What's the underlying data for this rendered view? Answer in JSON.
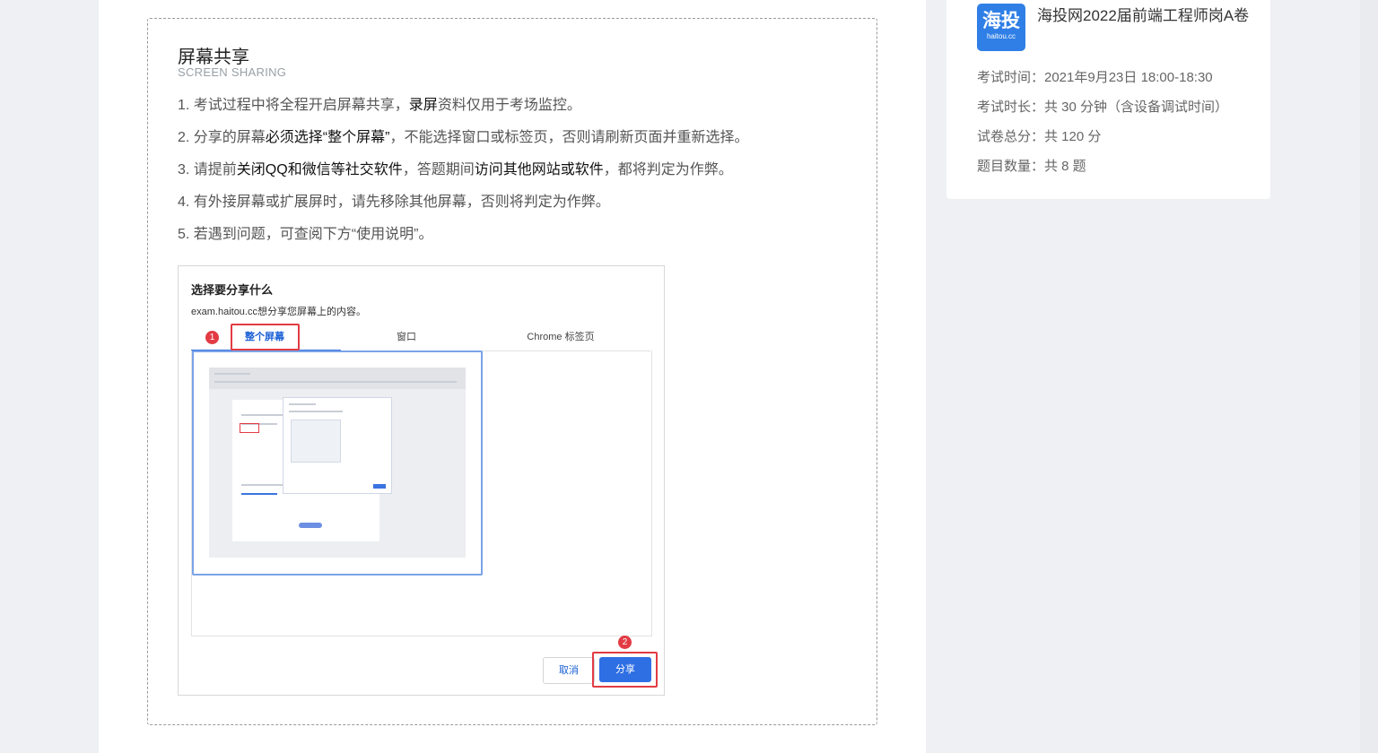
{
  "section": {
    "title": "屏幕共享",
    "subtitle": "SCREEN SHARING",
    "rules": [
      [
        {
          "t": "1. 考试过程中将全程开启屏幕共享，"
        },
        {
          "t": "录屏",
          "b": true
        },
        {
          "t": "资料仅用于考场监控。"
        }
      ],
      [
        {
          "t": "2. 分享的屏幕"
        },
        {
          "t": "必须选择“整个屏幕”",
          "b": true
        },
        {
          "t": "，不能选择窗口或标签页，否则请刷新页面并重新选择。"
        }
      ],
      [
        {
          "t": "3. 请提前"
        },
        {
          "t": "关闭QQ和微信等社交软件",
          "b": true
        },
        {
          "t": "，答题期间"
        },
        {
          "t": "访问其他网站或软件",
          "b": true
        },
        {
          "t": "，都将判定为作弊。"
        }
      ],
      [
        {
          "t": "4. 有外接屏幕或扩展屏时，请先移除其他屏幕，否则将判定为作弊。"
        }
      ],
      [
        {
          "t": "5. 若遇到问题，可查阅下方“使用说明”。"
        }
      ]
    ]
  },
  "dialog": {
    "title": "选择要分享什么",
    "desc": "exam.haitou.cc想分享您屏幕上的内容。",
    "tabs": [
      "整个屏幕",
      "窗口",
      "Chrome 标签页"
    ],
    "badge1": "1",
    "badge2": "2",
    "cancel_label": "取消",
    "share_label": "分享",
    "highlight_color": "#e23b44",
    "accent_color": "#2f6fe4"
  },
  "exam": {
    "logo_text": "海投",
    "logo_sub": "haitou.cc",
    "title": "海投网2022届前端工程师岗A卷",
    "info": [
      "考试时间：2021年9月23日 18:00-18:30",
      "考试时长：共 30 分钟（含设备调试时间）",
      "试卷总分：共 120 分",
      "题目数量：共 8 题"
    ]
  }
}
